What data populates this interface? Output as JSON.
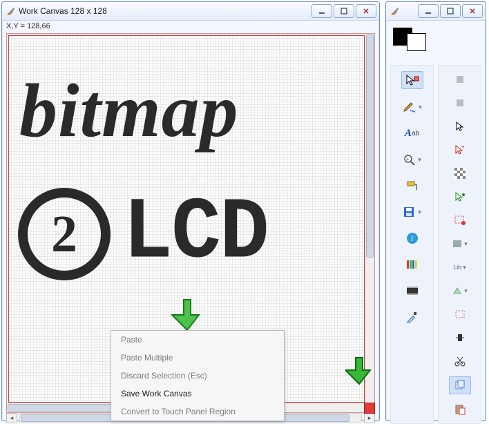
{
  "main_window": {
    "title": "Work Canvas 128 x 128",
    "status_coords": "X,Y = 128,66",
    "canvas_text_top": "bitmap",
    "canvas_text_circle": "2",
    "canvas_text_right": "LCD"
  },
  "context_menu": {
    "items": [
      {
        "label": "Paste",
        "enabled": false
      },
      {
        "label": "Paste Multiple",
        "enabled": false
      },
      {
        "label": "Discard Selection (Esc)",
        "enabled": false
      },
      {
        "label": "Save Work Canvas",
        "enabled": true
      },
      {
        "label": "Convert to Touch Panel Region",
        "enabled": false
      }
    ]
  },
  "toolbox_window": {
    "swatch_fg": "#000000",
    "swatch_bg": "#ffffff",
    "left_tools": [
      {
        "name": "select-move-tool",
        "icon": "cursor-sel"
      },
      {
        "name": "pencil-tool",
        "icon": "pencil"
      },
      {
        "name": "text-tool",
        "icon": "text-A"
      },
      {
        "name": "zoom-tool",
        "icon": "magnifier"
      },
      {
        "name": "paint-tool",
        "icon": "paintroller"
      },
      {
        "name": "save-tool",
        "icon": "disk"
      },
      {
        "name": "info-tool",
        "icon": "info"
      },
      {
        "name": "color-bars-tool",
        "icon": "colorbars"
      },
      {
        "name": "film-tool",
        "icon": "film"
      },
      {
        "name": "eyedropper-tool",
        "icon": "eyedropper"
      }
    ],
    "right_tools": [
      {
        "name": "tool-r1",
        "icon": "square-dot"
      },
      {
        "name": "tool-r2",
        "icon": "square-dot"
      },
      {
        "name": "cursor-tool",
        "icon": "cursor"
      },
      {
        "name": "cursor-plus-tool",
        "icon": "cursor-plus"
      },
      {
        "name": "dither-tool",
        "icon": "dither"
      },
      {
        "name": "cursor-green-tool",
        "icon": "cursor-green"
      },
      {
        "name": "select-region-tool",
        "icon": "sel-region"
      },
      {
        "name": "fill-tool",
        "icon": "fill"
      },
      {
        "name": "lib-tool",
        "icon": "lib"
      },
      {
        "name": "shape-tool",
        "icon": "shape"
      },
      {
        "name": "marquee-tool",
        "icon": "marquee"
      },
      {
        "name": "insert-tool",
        "icon": "insert"
      },
      {
        "name": "cut-tool",
        "icon": "scissors"
      },
      {
        "name": "copy-tool",
        "icon": "copy",
        "active": true
      },
      {
        "name": "paste-tool",
        "icon": "paste"
      }
    ],
    "lib_label": "Lib"
  },
  "arrows": {
    "green1": "#3db33d",
    "green2": "#2fa82f",
    "blue": "#4f6fbf",
    "red": "#e23b3b"
  }
}
